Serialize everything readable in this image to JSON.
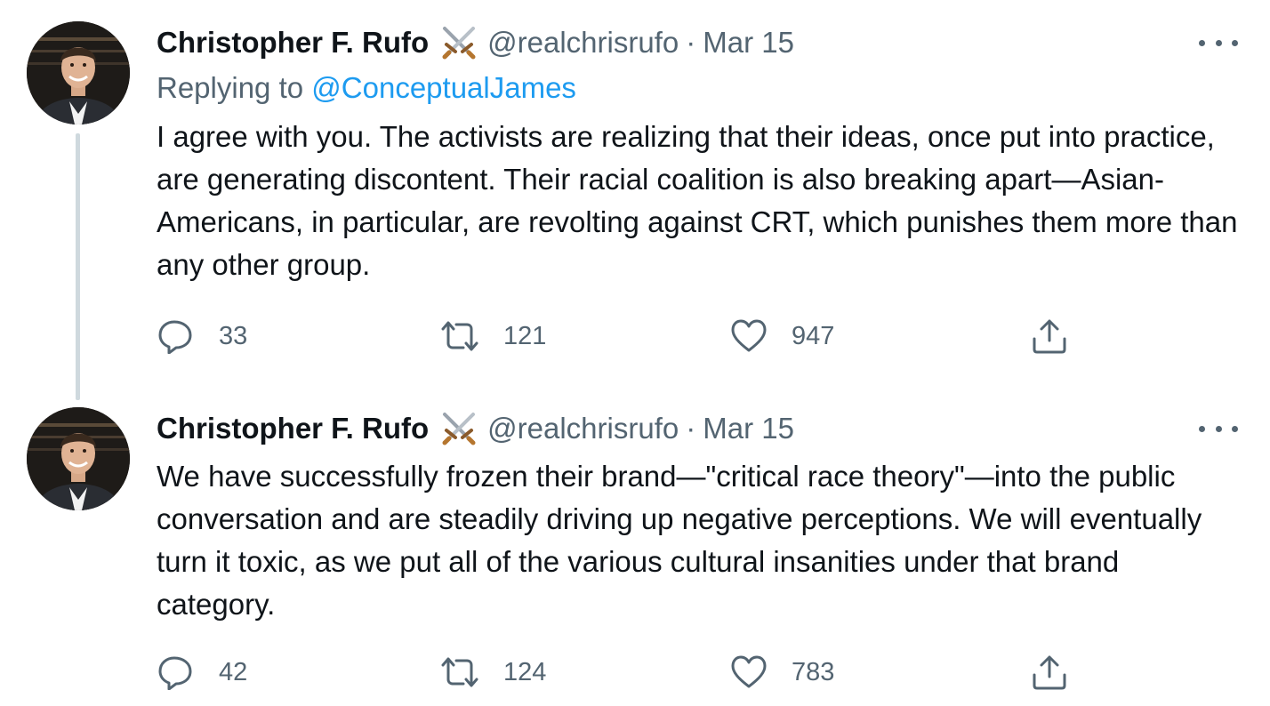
{
  "colors": {
    "text": "#0f1419",
    "secondary": "#536471",
    "link": "#1d9bf0",
    "thread_line": "#cfd9de",
    "background": "#ffffff"
  },
  "tweets": [
    {
      "author": {
        "name": "Christopher F. Rufo",
        "name_icon": "crossed-swords-icon",
        "handle": "@realchrisrufo"
      },
      "separator": "·",
      "date": "Mar 15",
      "replying_prefix": "Replying to",
      "replying_to": "@ConceptualJames",
      "text": "I agree with you. The activists are realizing that their ideas, once put into practice, are generating discontent. Their racial coalition is also breaking apart—Asian-Americans, in particular, are revolting against CRT, which punishes them more than any other group.",
      "counts": {
        "replies": "33",
        "retweets": "121",
        "likes": "947"
      },
      "icons": [
        "reply-icon",
        "retweet-icon",
        "like-icon",
        "share-icon",
        "more-icon"
      ]
    },
    {
      "author": {
        "name": "Christopher F. Rufo",
        "name_icon": "crossed-swords-icon",
        "handle": "@realchrisrufo"
      },
      "separator": "·",
      "date": "Mar 15",
      "text": "We have successfully frozen their brand—\"critical race theory\"—into the public conversation and are steadily driving up negative perceptions. We will eventually turn it toxic, as we put all of the various cultural insanities under that brand category.",
      "counts": {
        "replies": "42",
        "retweets": "124",
        "likes": "783"
      },
      "icons": [
        "reply-icon",
        "retweet-icon",
        "like-icon",
        "share-icon",
        "more-icon"
      ]
    }
  ]
}
